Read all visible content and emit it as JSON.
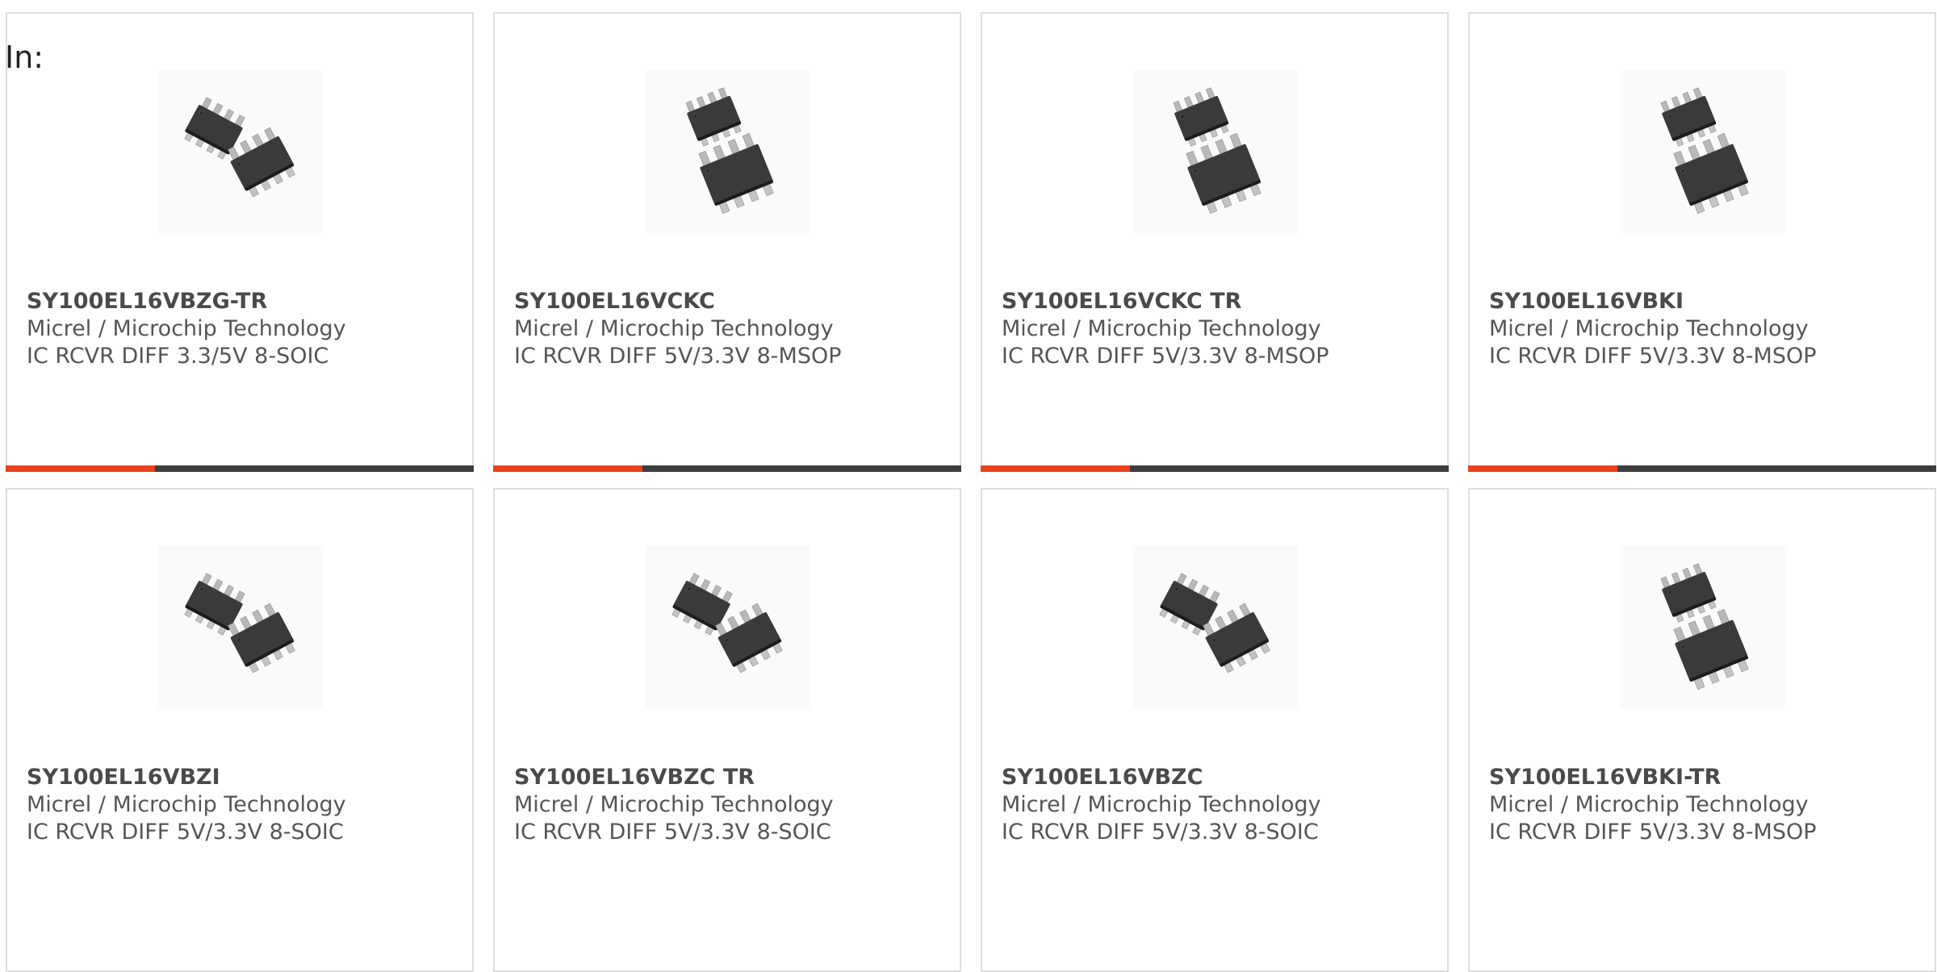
{
  "header": {
    "label": "In:"
  },
  "colors": {
    "accent": "#e8421d",
    "bar": "#3d3d3d",
    "border": "#dedede"
  },
  "products": [
    {
      "part": "SY100EL16VBZG-TR",
      "manufacturer": "Micrel / Microchip Technology",
      "description": "IC RCVR DIFF 3.3/5V 8-SOIC",
      "package_icon": "soic-8-chip-icon",
      "has_bar": true
    },
    {
      "part": "SY100EL16VCKC",
      "manufacturer": "Micrel / Microchip Technology",
      "description": "IC RCVR DIFF 5V/3.3V 8-MSOP",
      "package_icon": "msop-8-chip-icon",
      "has_bar": true
    },
    {
      "part": "SY100EL16VCKC TR",
      "manufacturer": "Micrel / Microchip Technology",
      "description": "IC RCVR DIFF 5V/3.3V 8-MSOP",
      "package_icon": "msop-8-chip-icon",
      "has_bar": true
    },
    {
      "part": "SY100EL16VBKI",
      "manufacturer": "Micrel / Microchip Technology",
      "description": "IC RCVR DIFF 5V/3.3V 8-MSOP",
      "package_icon": "msop-8-chip-icon",
      "has_bar": true
    },
    {
      "part": "SY100EL16VBZI",
      "manufacturer": "Micrel / Microchip Technology",
      "description": "IC RCVR DIFF 5V/3.3V 8-SOIC",
      "package_icon": "soic-8-chip-icon",
      "has_bar": false
    },
    {
      "part": "SY100EL16VBZC TR",
      "manufacturer": "Micrel / Microchip Technology",
      "description": "IC RCVR DIFF 5V/3.3V 8-SOIC",
      "package_icon": "soic-8-chip-icon",
      "has_bar": false
    },
    {
      "part": "SY100EL16VBZC",
      "manufacturer": "Micrel / Microchip Technology",
      "description": "IC RCVR DIFF 5V/3.3V 8-SOIC",
      "package_icon": "soic-8-chip-icon",
      "has_bar": false
    },
    {
      "part": "SY100EL16VBKI-TR",
      "manufacturer": "Micrel / Microchip Technology",
      "description": "IC RCVR DIFF 5V/3.3V 8-MSOP",
      "package_icon": "msop-8-chip-icon",
      "has_bar": false
    }
  ]
}
